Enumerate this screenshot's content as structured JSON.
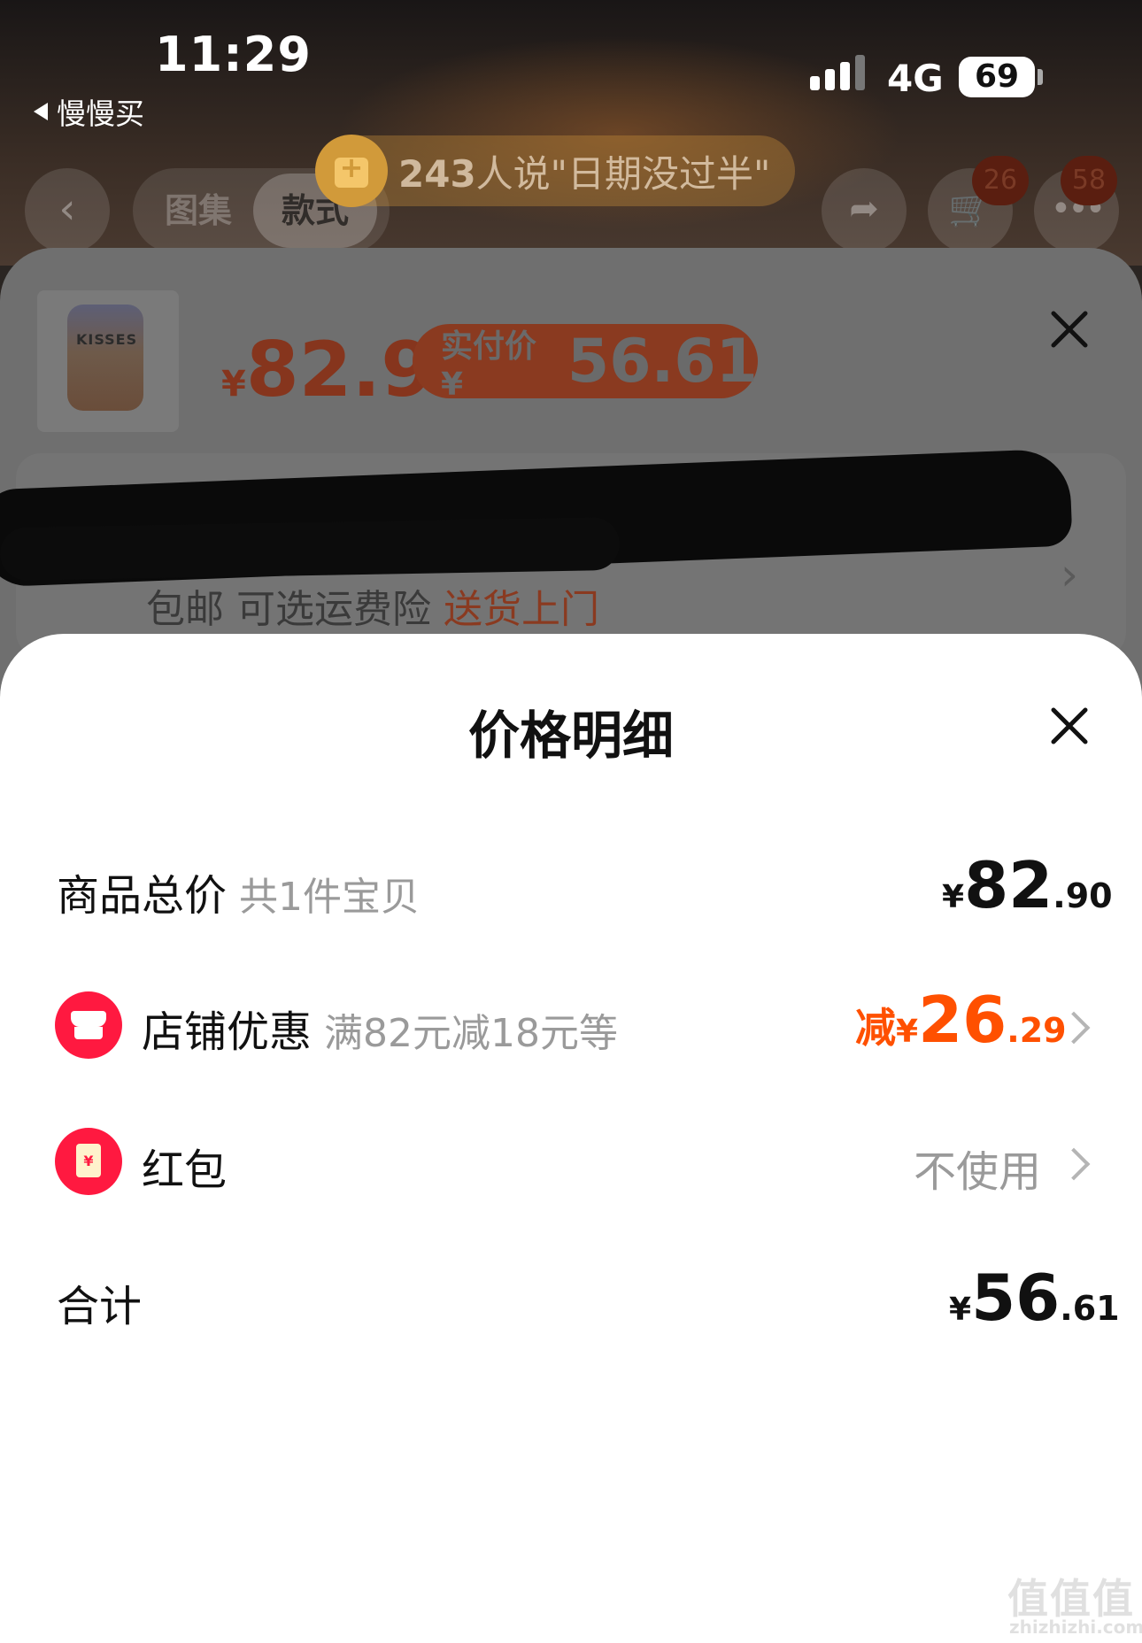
{
  "status_bar": {
    "time": "11:29",
    "back_app": "慢慢买",
    "network": "4G",
    "battery": "69"
  },
  "top_nav": {
    "tabs": [
      "图集",
      "款式"
    ],
    "cart_badge": "26",
    "more_badge": "58",
    "banner_count": "243",
    "banner_text": "人说\"日期没过半\""
  },
  "product_panel": {
    "price_symbol": "¥",
    "price": "82.9",
    "pay_label": "实付价 ¥",
    "pay_amount": "56.61",
    "shipping_text": "包邮 可选运费险",
    "shipping_accent": "送货上门",
    "thumb_label": "KISSES"
  },
  "price_detail": {
    "title": "价格明细",
    "rows": [
      {
        "label": "商品总价",
        "sub": "共1件宝贝",
        "currency": "¥",
        "int": "82",
        "dec": ".90"
      },
      {
        "label": "店铺优惠",
        "sub": "满82元减18元等",
        "prefix": "减",
        "currency": "¥",
        "int": "26",
        "dec": ".29"
      },
      {
        "label": "红包",
        "value": "不使用"
      },
      {
        "label": "合计",
        "currency": "¥",
        "int": "56",
        "dec": ".61"
      }
    ]
  },
  "icons": {
    "store": "store-icon",
    "red_packet": "red-packet-icon",
    "close": "close-icon",
    "chevron": "chevron-right-icon"
  },
  "colors": {
    "accent": "#ff5000",
    "icon_red": "#ff1940"
  },
  "watermark": {
    "text": "值值值",
    "url": "zhizhizhi.com"
  }
}
